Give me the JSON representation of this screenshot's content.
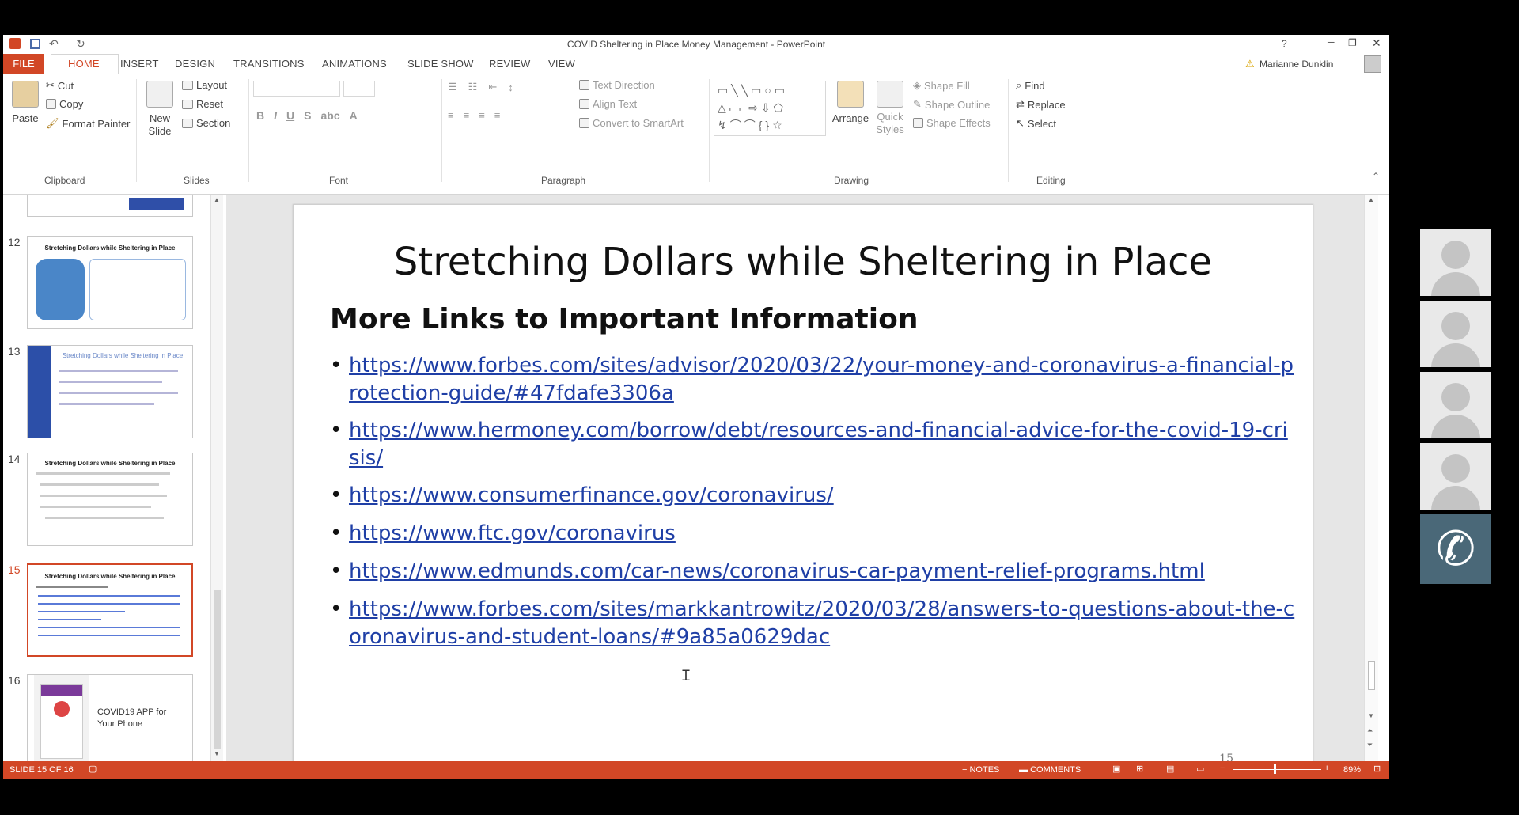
{
  "window": {
    "title": "COVID Sheltering in Place Money Management - PowerPoint",
    "user": "Marianne Dunklin"
  },
  "tabs": [
    "FILE",
    "HOME",
    "INSERT",
    "DESIGN",
    "TRANSITIONS",
    "ANIMATIONS",
    "SLIDE SHOW",
    "REVIEW",
    "VIEW"
  ],
  "ribbon": {
    "clipboard": {
      "paste": "Paste",
      "cut": "Cut",
      "copy": "Copy",
      "format_painter": "Format Painter",
      "label": "Clipboard"
    },
    "slides": {
      "new_slide": "New Slide",
      "layout": "Layout",
      "reset": "Reset",
      "section": "Section",
      "label": "Slides"
    },
    "font": {
      "label": "Font"
    },
    "paragraph": {
      "text_direction": "Text Direction",
      "align_text": "Align Text",
      "convert": "Convert to SmartArt",
      "label": "Paragraph"
    },
    "drawing": {
      "arrange": "Arrange",
      "quick_styles": "Quick Styles",
      "shape_fill": "Shape Fill",
      "shape_outline": "Shape Outline",
      "shape_effects": "Shape Effects",
      "label": "Drawing"
    },
    "editing": {
      "find": "Find",
      "replace": "Replace",
      "select": "Select",
      "label": "Editing"
    }
  },
  "thumbnails": [
    {
      "num": "12",
      "title": "Stretching Dollars while Sheltering in Place"
    },
    {
      "num": "13",
      "title": "Stretching Dollars while Sheltering in Place"
    },
    {
      "num": "14",
      "title": "Stretching Dollars while Sheltering in Place"
    },
    {
      "num": "15",
      "title": "Stretching Dollars while Sheltering in Place"
    },
    {
      "num": "16",
      "title": "COVID19 APP for Your Phone"
    }
  ],
  "slide": {
    "title": "Stretching Dollars while Sheltering in Place",
    "subtitle": "More Links to Important Information",
    "links": [
      "https://www.forbes.com/sites/advisor/2020/03/22/your-money-and-coronavirus-a-financial-protection-guide/#47fdafe3306a",
      "https://www.hermoney.com/borrow/debt/resources-and-financial-advice-for-the-covid-19-crisis/",
      "https://www.consumerfinance.gov/coronavirus/",
      "https://www.ftc.gov/coronavirus",
      "https://www.edmunds.com/car-news/coronavirus-car-payment-relief-programs.html",
      "https://www.forbes.com/sites/markkantrowitz/2020/03/28/answers-to-questions-about-the-coronavirus-and-student-loans/#9a85a0629dac"
    ],
    "page_number": "15"
  },
  "status": {
    "slide_of": "SLIDE 15 OF 16",
    "notes": "NOTES",
    "comments": "COMMENTS",
    "zoom": "89%"
  },
  "colors": {
    "accent": "#d24726",
    "link": "#1f3fa6"
  }
}
